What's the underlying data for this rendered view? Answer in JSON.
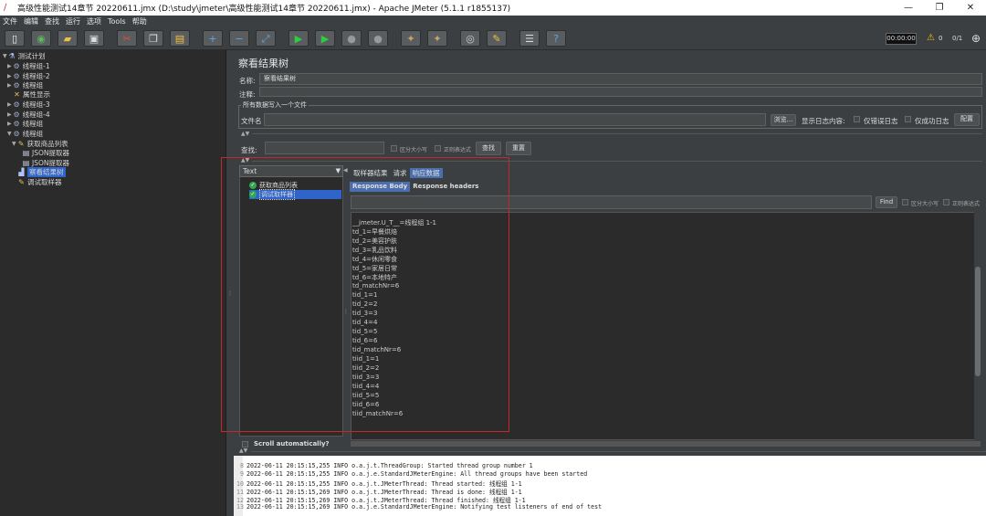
{
  "window": {
    "title": "高级性能测试14章节 20220611.jmx (D:\\study\\jmeter\\高级性能测试14章节 20220611.jmx) - Apache JMeter (5.1.1 r1855137)",
    "minimize": "—",
    "maximize": "❐",
    "close": "✕"
  },
  "menu": [
    "文件",
    "编辑",
    "查找",
    "运行",
    "选项",
    "Tools",
    "帮助"
  ],
  "toolbar": {
    "timer": "00:00:00",
    "warn_count": "0",
    "threads": "0/1"
  },
  "tree": [
    {
      "label": "测试计划",
      "icon": "plan-icon",
      "glyph": "⚗",
      "cls": "chart"
    },
    {
      "label": "线程组-1",
      "icon": "gear-icon",
      "glyph": "⚙",
      "cls": "gear"
    },
    {
      "label": "线程组-2",
      "icon": "gear-icon",
      "glyph": "⚙",
      "cls": "gear"
    },
    {
      "label": "线程组",
      "icon": "gear-icon",
      "glyph": "⚙",
      "cls": "gear"
    },
    {
      "label": "属性显示",
      "icon": "tools-icon",
      "glyph": "✕",
      "cls": "pen"
    },
    {
      "label": "线程组-3",
      "icon": "gear-icon",
      "glyph": "⚙",
      "cls": "gear"
    },
    {
      "label": "线程组-4",
      "icon": "gear-icon",
      "glyph": "⚙",
      "cls": "gear"
    },
    {
      "label": "线程组",
      "icon": "gear-icon",
      "glyph": "⚙",
      "cls": "gear"
    },
    {
      "label": "线程组",
      "icon": "gear-icon",
      "glyph": "⚙",
      "cls": "gear"
    },
    {
      "label": "获取商品列表",
      "icon": "pen-icon",
      "glyph": "✎",
      "cls": "pen"
    },
    {
      "label": "JSON提取器",
      "icon": "document-icon",
      "glyph": "▤",
      "cls": "doc"
    },
    {
      "label": "JSON提取器",
      "icon": "document-icon",
      "glyph": "▤",
      "cls": "doc"
    },
    {
      "label": "察看结果树",
      "icon": "chart-icon",
      "glyph": "▟",
      "cls": "chart"
    },
    {
      "label": "调试取样器",
      "icon": "pen-icon",
      "glyph": "✎",
      "cls": "pen"
    }
  ],
  "panel": {
    "title": "察看结果树",
    "name_label": "名称:",
    "name_value": "察看结果树",
    "comment_label": "注释:",
    "group_title": "所有数据写入一个文件",
    "file_label": "文件名",
    "browse_button": "浏览...",
    "log_content_label": "显示日志内容:",
    "errors_only": "仅错误日志",
    "success_only": "仅成功日志",
    "configure_button": "配置",
    "search_label": "查找:",
    "case_sensitive": "区分大小写",
    "regex": "正则表达式",
    "search_button": "查找",
    "reset_button": "重置"
  },
  "results": {
    "renderer": "Text",
    "items": [
      "获取商品列表",
      "调试取样器"
    ],
    "scroll_auto": "Scroll automatically?",
    "tabs": [
      "取样器结果",
      "请求",
      "响应数据"
    ],
    "subtabs": [
      "Response Body",
      "Response headers"
    ],
    "find_button": "Find",
    "find_case": "区分大小写",
    "find_regex": "正则表达式",
    "body_lines": [
      "__jmeter.U_T__=线程组 1-1",
      "td_1=早餐烘焙",
      "td_2=美容护肤",
      "td_3=乳品饮料",
      "td_4=休闲零食",
      "td_5=家居日常",
      "td_6=本地特产",
      "td_matchNr=6",
      "tid_1=1",
      "tid_2=2",
      "tid_3=3",
      "tid_4=4",
      "tid_5=5",
      "tid_6=6",
      "tid_matchNr=6",
      "tiid_1=1",
      "tiid_2=2",
      "tiid_3=3",
      "tiid_4=4",
      "tiid_5=5",
      "tiid_6=6",
      "tiid_matchNr=6"
    ]
  },
  "log": [
    {
      "n": "8",
      "text": "2022-06-11 20:15:15,255 INFO o.a.j.t.ThreadGroup: Started thread group number 1"
    },
    {
      "n": "9",
      "text": "2022-06-11 20:15:15,255 INFO o.a.j.e.StandardJMeterEngine: All thread groups have been started"
    },
    {
      "n": "10",
      "text": "2022-06-11 20:15:15,255 INFO o.a.j.t.JMeterThread: Thread started: 线程组 1-1"
    },
    {
      "n": "11",
      "text": "2022-06-11 20:15:15,269 INFO o.a.j.t.JMeterThread: Thread is done: 线程组 1-1"
    },
    {
      "n": "12",
      "text": "2022-06-11 20:15:15,269 INFO o.a.j.t.JMeterThread: Thread finished: 线程组 1-1"
    },
    {
      "n": "13",
      "text": "2022-06-11 20:15:15,269 INFO o.a.j.e.StandardJMeterEngine: Notifying test listeners of end of test"
    }
  ]
}
